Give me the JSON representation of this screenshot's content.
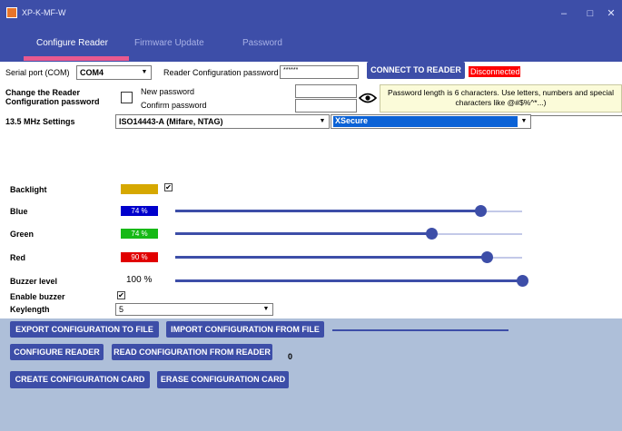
{
  "window": {
    "title": "XP-K-MF-W",
    "minimize": "–",
    "maximize": "□",
    "close": "✕",
    "icon": "app-icon"
  },
  "tabs": [
    {
      "label": "Configure Reader",
      "active": true
    },
    {
      "label": "Firmware Update",
      "active": false
    },
    {
      "label": "Password",
      "active": false
    }
  ],
  "connection": {
    "serial_port_label": "Serial port (COM)",
    "serial_port_value": "COM4",
    "reader_password_label": "Reader Configuration password",
    "reader_password_value": "******",
    "connect_button": "CONNECT TO READER",
    "status": "Disconnected",
    "status_color": "#ff0000"
  },
  "password_change": {
    "label": "Change the Reader Configuration password",
    "new_password_label": "New password",
    "confirm_password_label": "Confirm password",
    "new_password_value": "",
    "confirm_password_value": "",
    "show_icon": "eye-icon",
    "hint": "Password length is 6 characters. Use letters, numbers and special characters like @#$%^*...)"
  },
  "settings_13_56": {
    "label": "13.5 MHz Settings",
    "protocol_value": "ISO14443-A (Mifare, NTAG)",
    "security_value": "XSecure"
  },
  "leds": {
    "backlight_label": "Backlight",
    "backlight_color": "#d6a800",
    "backlight_checked": true,
    "check_mark": "✔",
    "blue_label": "Blue",
    "blue_value": "74 %",
    "blue_level": 0.88,
    "blue_color": "#0000cc",
    "green_label": "Green",
    "green_value": "74 %",
    "green_level": 0.74,
    "green_color": "#16b916",
    "red_label": "Red",
    "red_value": "90 %",
    "red_level": 0.9,
    "red_color": "#e10000"
  },
  "buzzer": {
    "level_label": "Buzzer level",
    "level_value": "100 %",
    "level": 1.0,
    "enable_label": "Enable buzzer",
    "enable_checked": true,
    "keylength_label": "Keylength",
    "keylength_value": "5"
  },
  "actions": {
    "export": "EXPORT CONFIGURATION TO FILE",
    "import": "IMPORT CONFIGURATION FROM FILE",
    "configure": "CONFIGURE READER",
    "read": "READ CONFIGURATION FROM READER",
    "read_count": "0",
    "create_card": "CREATE CONFIGURATION CARD",
    "erase_card": "ERASE CONFIGURATION CARD"
  }
}
